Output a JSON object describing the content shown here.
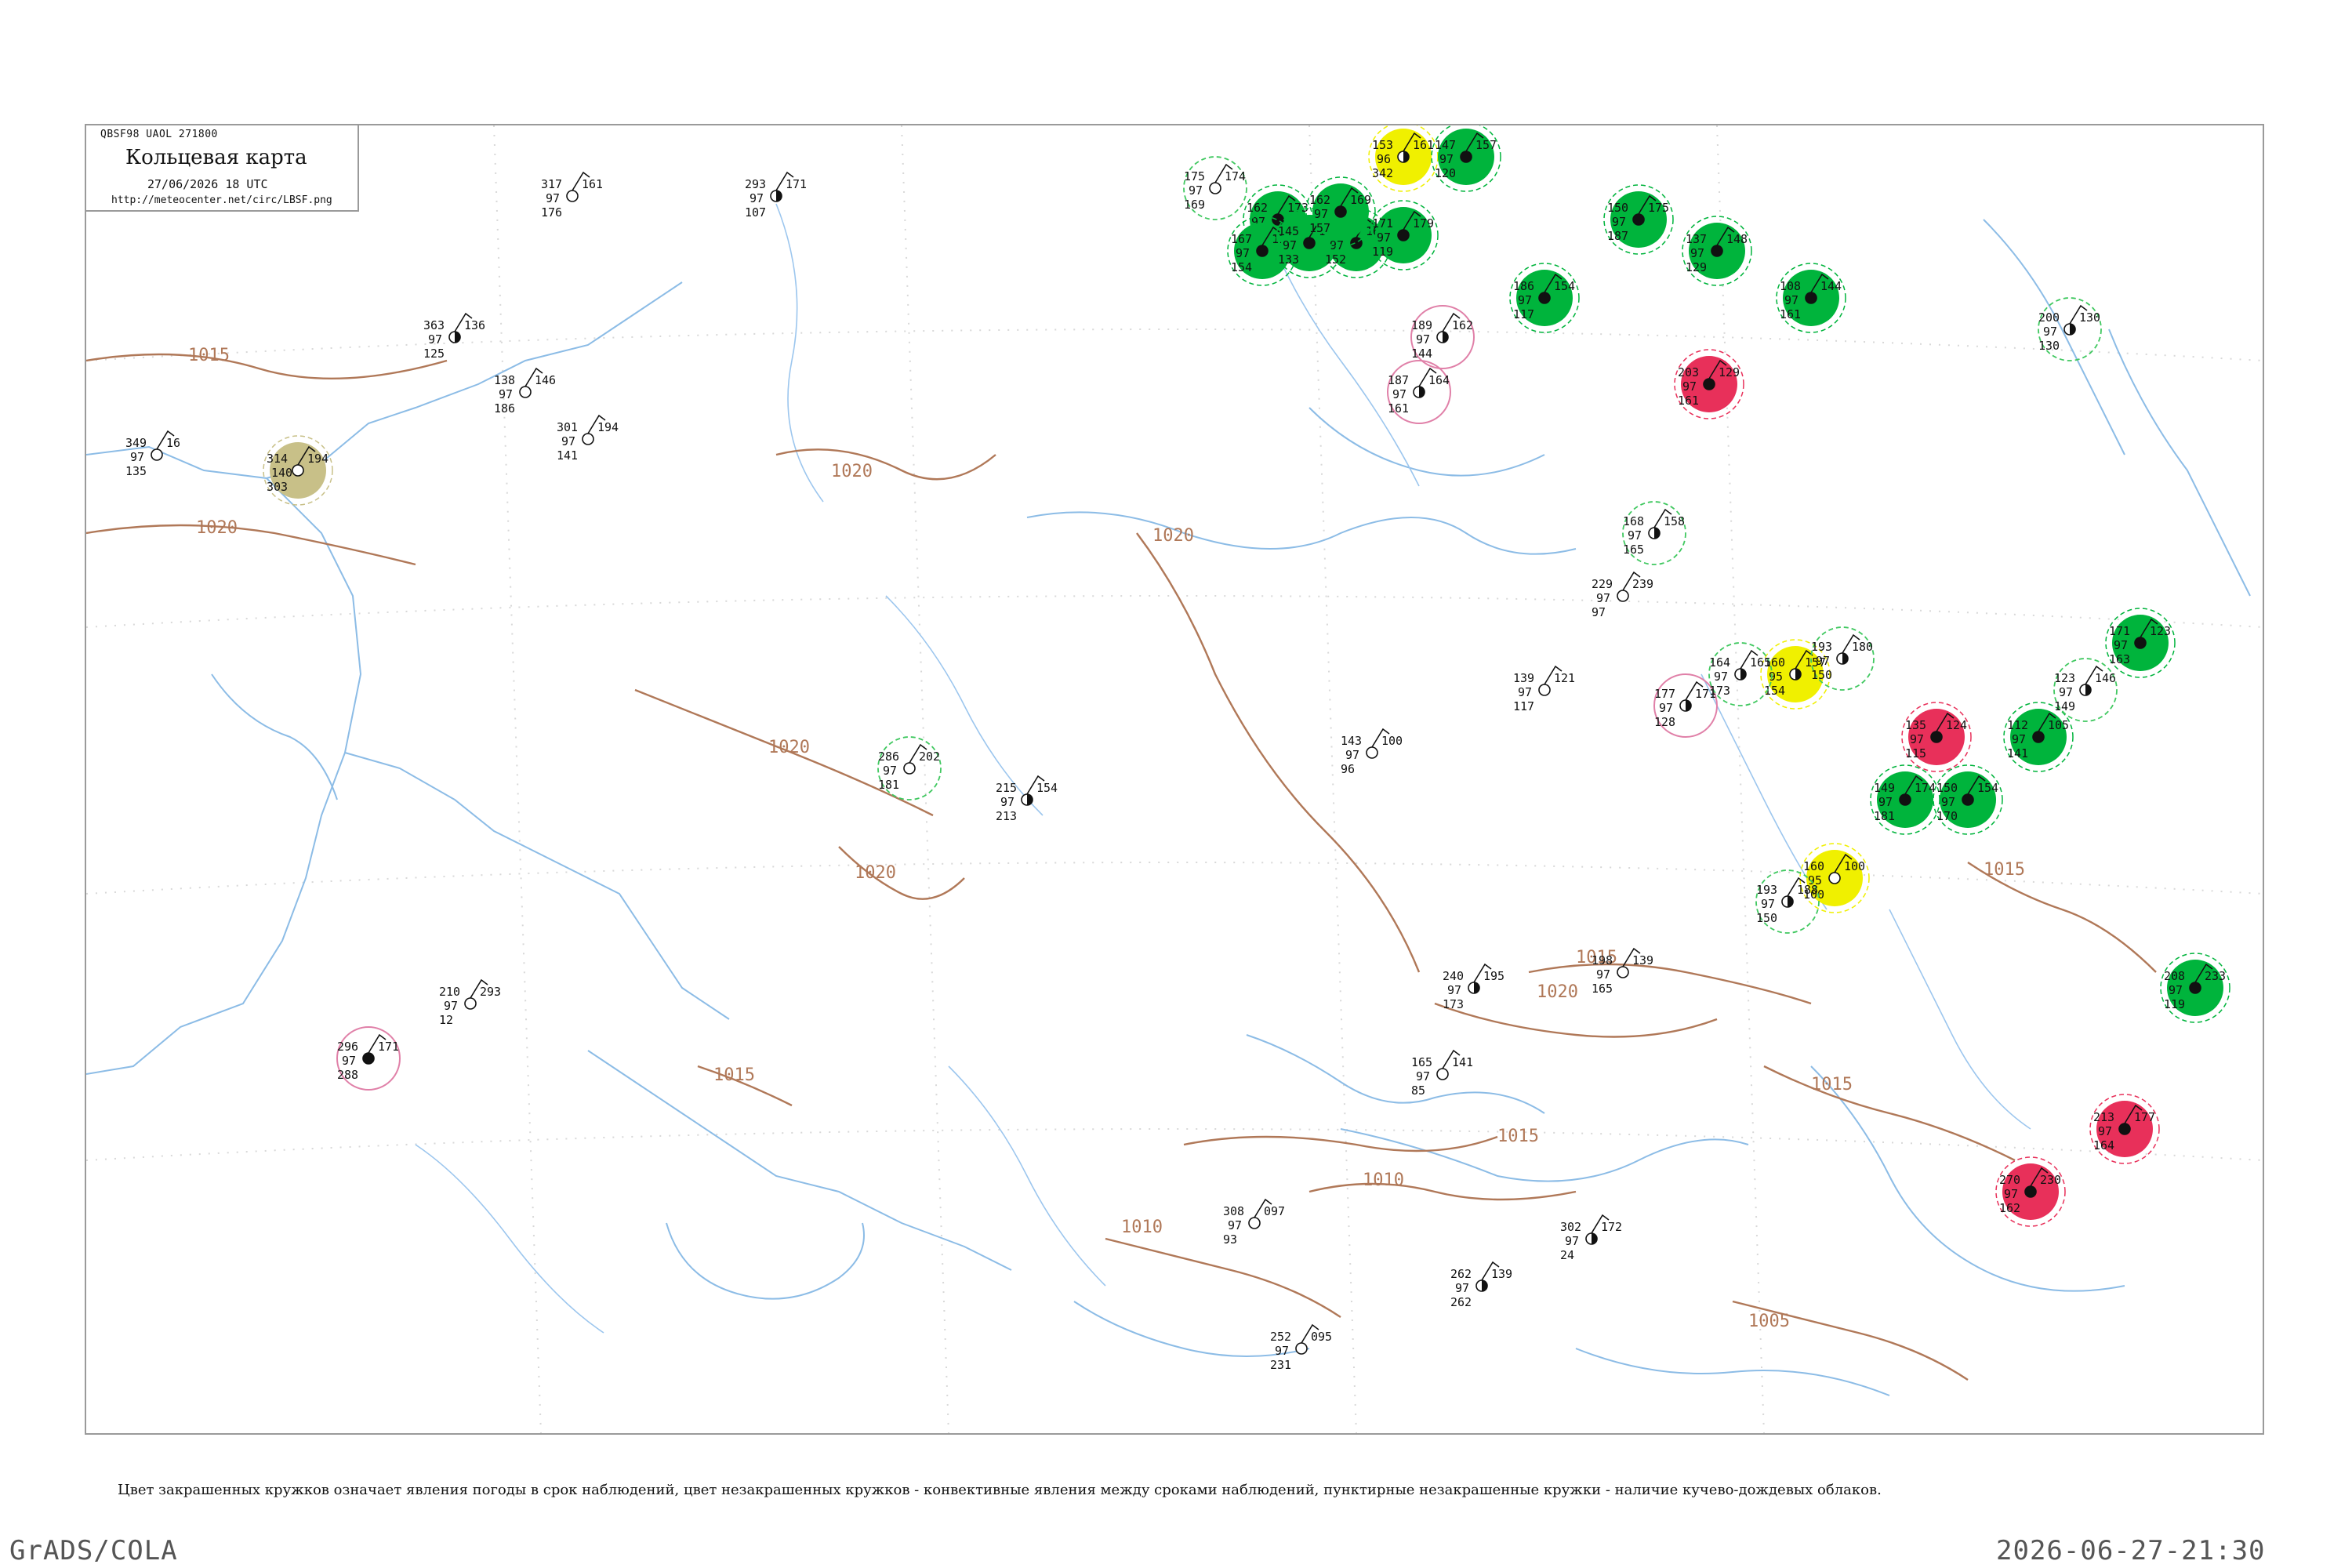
{
  "header": {
    "code": "QBSF98  UAOL  271800",
    "title": "Кольцевая карта",
    "date": "27/06/2026 18 UTC",
    "url": "http://meteocenter.net/circ/LBSF.png"
  },
  "isobars": [
    {
      "label": "1015"
    },
    {
      "label": "1020"
    },
    {
      "label": "1020"
    },
    {
      "label": "1020"
    },
    {
      "label": "1020"
    },
    {
      "label": "1020"
    },
    {
      "label": "1015"
    },
    {
      "label": "1015"
    },
    {
      "label": "1010"
    },
    {
      "label": "1015"
    },
    {
      "label": "1015"
    },
    {
      "label": "1005"
    },
    {
      "label": "1020"
    },
    {
      "label": "1010"
    },
    {
      "label": "1015"
    }
  ],
  "stations": [
    {
      "temp": "349",
      "dew": "97",
      "pres": "135",
      "code": "16",
      "symbol": "clear",
      "halo": "none"
    },
    {
      "temp": "314",
      "dew": "140",
      "pres": "303",
      "code": "194",
      "symbol": "clear",
      "halo": "olive"
    },
    {
      "temp": "138",
      "dew": "97",
      "pres": "186",
      "code": "146",
      "symbol": "clear",
      "halo": "none"
    },
    {
      "temp": "363",
      "dew": "97",
      "pres": "125",
      "code": "136",
      "symbol": "half",
      "halo": "none"
    },
    {
      "temp": "317",
      "dew": "97",
      "pres": "176",
      "code": "161",
      "symbol": "clear",
      "halo": "none"
    },
    {
      "temp": "293",
      "dew": "97",
      "pres": "107",
      "code": "171",
      "symbol": "half",
      "halo": "none"
    },
    {
      "temp": "286",
      "dew": "97",
      "pres": "181",
      "code": "202",
      "symbol": "clear",
      "halo": "dashgreen"
    },
    {
      "temp": "210",
      "dew": "97",
      "pres": "12",
      "code": "293",
      "symbol": "clear",
      "halo": "none"
    },
    {
      "temp": "301",
      "dew": "97",
      "pres": "141",
      "code": "194",
      "symbol": "clear",
      "halo": "none"
    },
    {
      "temp": "296",
      "dew": "97",
      "pres": "288",
      "code": "171",
      "symbol": "full",
      "halo": "pink"
    },
    {
      "temp": "175",
      "dew": "97",
      "pres": "169",
      "code": "174",
      "symbol": "clear",
      "halo": "dashgreen"
    },
    {
      "temp": "162",
      "dew": "97",
      "pres": "140",
      "code": "173",
      "symbol": "full",
      "halo": "green"
    },
    {
      "temp": "153",
      "dew": "96",
      "pres": "342",
      "code": "161",
      "symbol": "half",
      "halo": "yellow"
    },
    {
      "temp": "167",
      "dew": "97",
      "pres": "154",
      "code": "115",
      "symbol": "full",
      "halo": "green"
    },
    {
      "temp": "145",
      "dew": "97",
      "pres": "133",
      "code": "128",
      "symbol": "full",
      "halo": "green"
    },
    {
      "temp": "170",
      "dew": "97",
      "pres": "152",
      "code": "164",
      "symbol": "full",
      "halo": "green"
    },
    {
      "temp": "171",
      "dew": "97",
      "pres": "119",
      "code": "179",
      "symbol": "full",
      "halo": "green"
    },
    {
      "temp": "162",
      "dew": "97",
      "pres": "157",
      "code": "169",
      "symbol": "full",
      "halo": "green"
    },
    {
      "temp": "147",
      "dew": "97",
      "pres": "120",
      "code": "157",
      "symbol": "full",
      "halo": "green"
    },
    {
      "temp": "186",
      "dew": "97",
      "pres": "117",
      "code": "154",
      "symbol": "full",
      "halo": "green"
    },
    {
      "temp": "150",
      "dew": "97",
      "pres": "187",
      "code": "175",
      "symbol": "full",
      "halo": "green"
    },
    {
      "temp": "137",
      "dew": "97",
      "pres": "129",
      "code": "148",
      "symbol": "full",
      "halo": "green"
    },
    {
      "temp": "189",
      "dew": "97",
      "pres": "144",
      "code": "162",
      "symbol": "half",
      "halo": "pink"
    },
    {
      "temp": "187",
      "dew": "97",
      "pres": "161",
      "code": "164",
      "symbol": "half",
      "halo": "pink"
    },
    {
      "temp": "203",
      "dew": "97",
      "pres": "161",
      "code": "129",
      "symbol": "full",
      "halo": "red"
    },
    {
      "temp": "160",
      "dew": "95",
      "pres": "154",
      "code": "157",
      "symbol": "half",
      "halo": "yellow"
    },
    {
      "temp": "160",
      "dew": "95",
      "pres": "100",
      "code": "100",
      "symbol": "clear",
      "halo": "yellow"
    },
    {
      "temp": "149",
      "dew": "97",
      "pres": "181",
      "code": "174",
      "symbol": "full",
      "halo": "green"
    },
    {
      "temp": "150",
      "dew": "97",
      "pres": "170",
      "code": "154",
      "symbol": "full",
      "halo": "green"
    },
    {
      "temp": "108",
      "dew": "97",
      "pres": "161",
      "code": "144",
      "symbol": "full",
      "halo": "green"
    },
    {
      "temp": "135",
      "dew": "97",
      "pres": "115",
      "code": "124",
      "symbol": "full",
      "halo": "red"
    },
    {
      "temp": "112",
      "dew": "97",
      "pres": "141",
      "code": "105",
      "symbol": "full",
      "halo": "green"
    },
    {
      "temp": "171",
      "dew": "97",
      "pres": "163",
      "code": "123",
      "symbol": "full",
      "halo": "green"
    },
    {
      "temp": "208",
      "dew": "97",
      "pres": "119",
      "code": "233",
      "symbol": "full",
      "halo": "green"
    },
    {
      "temp": "213",
      "dew": "97",
      "pres": "164",
      "code": "177",
      "symbol": "full",
      "halo": "red"
    },
    {
      "temp": "270",
      "dew": "97",
      "pres": "162",
      "code": "230",
      "symbol": "full",
      "halo": "red"
    },
    {
      "temp": "177",
      "dew": "97",
      "pres": "128",
      "code": "171",
      "symbol": "half",
      "halo": "pink"
    },
    {
      "temp": "164",
      "dew": "97",
      "pres": "173",
      "code": "165",
      "symbol": "half",
      "halo": "dashgreen"
    },
    {
      "temp": "193",
      "dew": "97",
      "pres": "150",
      "code": "180",
      "symbol": "half",
      "halo": "dashgreen"
    },
    {
      "temp": "168",
      "dew": "97",
      "pres": "165",
      "code": "158",
      "symbol": "half",
      "halo": "dashgreen"
    },
    {
      "temp": "229",
      "dew": "97",
      "pres": "97",
      "code": "239",
      "symbol": "clear",
      "halo": "none"
    },
    {
      "temp": "198",
      "dew": "97",
      "pres": "165",
      "code": "139",
      "symbol": "clear",
      "halo": "none"
    },
    {
      "temp": "240",
      "dew": "97",
      "pres": "173",
      "code": "195",
      "symbol": "half",
      "halo": "none"
    },
    {
      "temp": "165",
      "dew": "97",
      "pres": "85",
      "code": "141",
      "symbol": "clear",
      "halo": "none"
    },
    {
      "temp": "215",
      "dew": "97",
      "pres": "213",
      "code": "154",
      "symbol": "half",
      "halo": "none"
    },
    {
      "temp": "308",
      "dew": "97",
      "pres": "93",
      "code": "097",
      "symbol": "clear",
      "halo": "none"
    },
    {
      "temp": "262",
      "dew": "97",
      "pres": "262",
      "code": "139",
      "symbol": "half",
      "halo": "none"
    },
    {
      "temp": "252",
      "dew": "97",
      "pres": "231",
      "code": "095",
      "symbol": "clear",
      "halo": "none"
    },
    {
      "temp": "302",
      "dew": "97",
      "pres": "24",
      "code": "172",
      "symbol": "half",
      "halo": "none"
    },
    {
      "temp": "193",
      "dew": "97",
      "pres": "150",
      "code": "188",
      "symbol": "half",
      "halo": "dashgreen"
    },
    {
      "temp": "139",
      "dew": "97",
      "pres": "117",
      "code": "121",
      "symbol": "clear",
      "halo": "none"
    },
    {
      "temp": "143",
      "dew": "97",
      "pres": "96",
      "code": "100",
      "symbol": "clear",
      "halo": "none"
    },
    {
      "temp": "123",
      "dew": "97",
      "pres": "149",
      "code": "146",
      "symbol": "half",
      "halo": "dashgreen"
    },
    {
      "temp": "200",
      "dew": "97",
      "pres": "130",
      "code": "130",
      "symbol": "half",
      "halo": "dashgreen"
    }
  ],
  "footnote": "Цвет закрашенных кружков означает явления погоды в срок наблюдений, цвет незакрашенных кружков - конвективные явления между сроками наблюдений, пунктирные незакрашенные кружки - наличие кучево-дождевых облаков.",
  "footer": {
    "left": "GrADS/COLA",
    "right": "2026-06-27-21:30"
  },
  "colors": {
    "coast": "#8cbce6",
    "river": "#9cc6ee",
    "isobar": "#b07858",
    "frame": "#9a9a9a",
    "halo_green": "#00b43c",
    "halo_red": "#e8305a",
    "halo_yellow": "#f0f000",
    "halo_olive": "#c8c088",
    "halo_pink": "#e080a8",
    "halo_dashgreen": "#40c860"
  }
}
